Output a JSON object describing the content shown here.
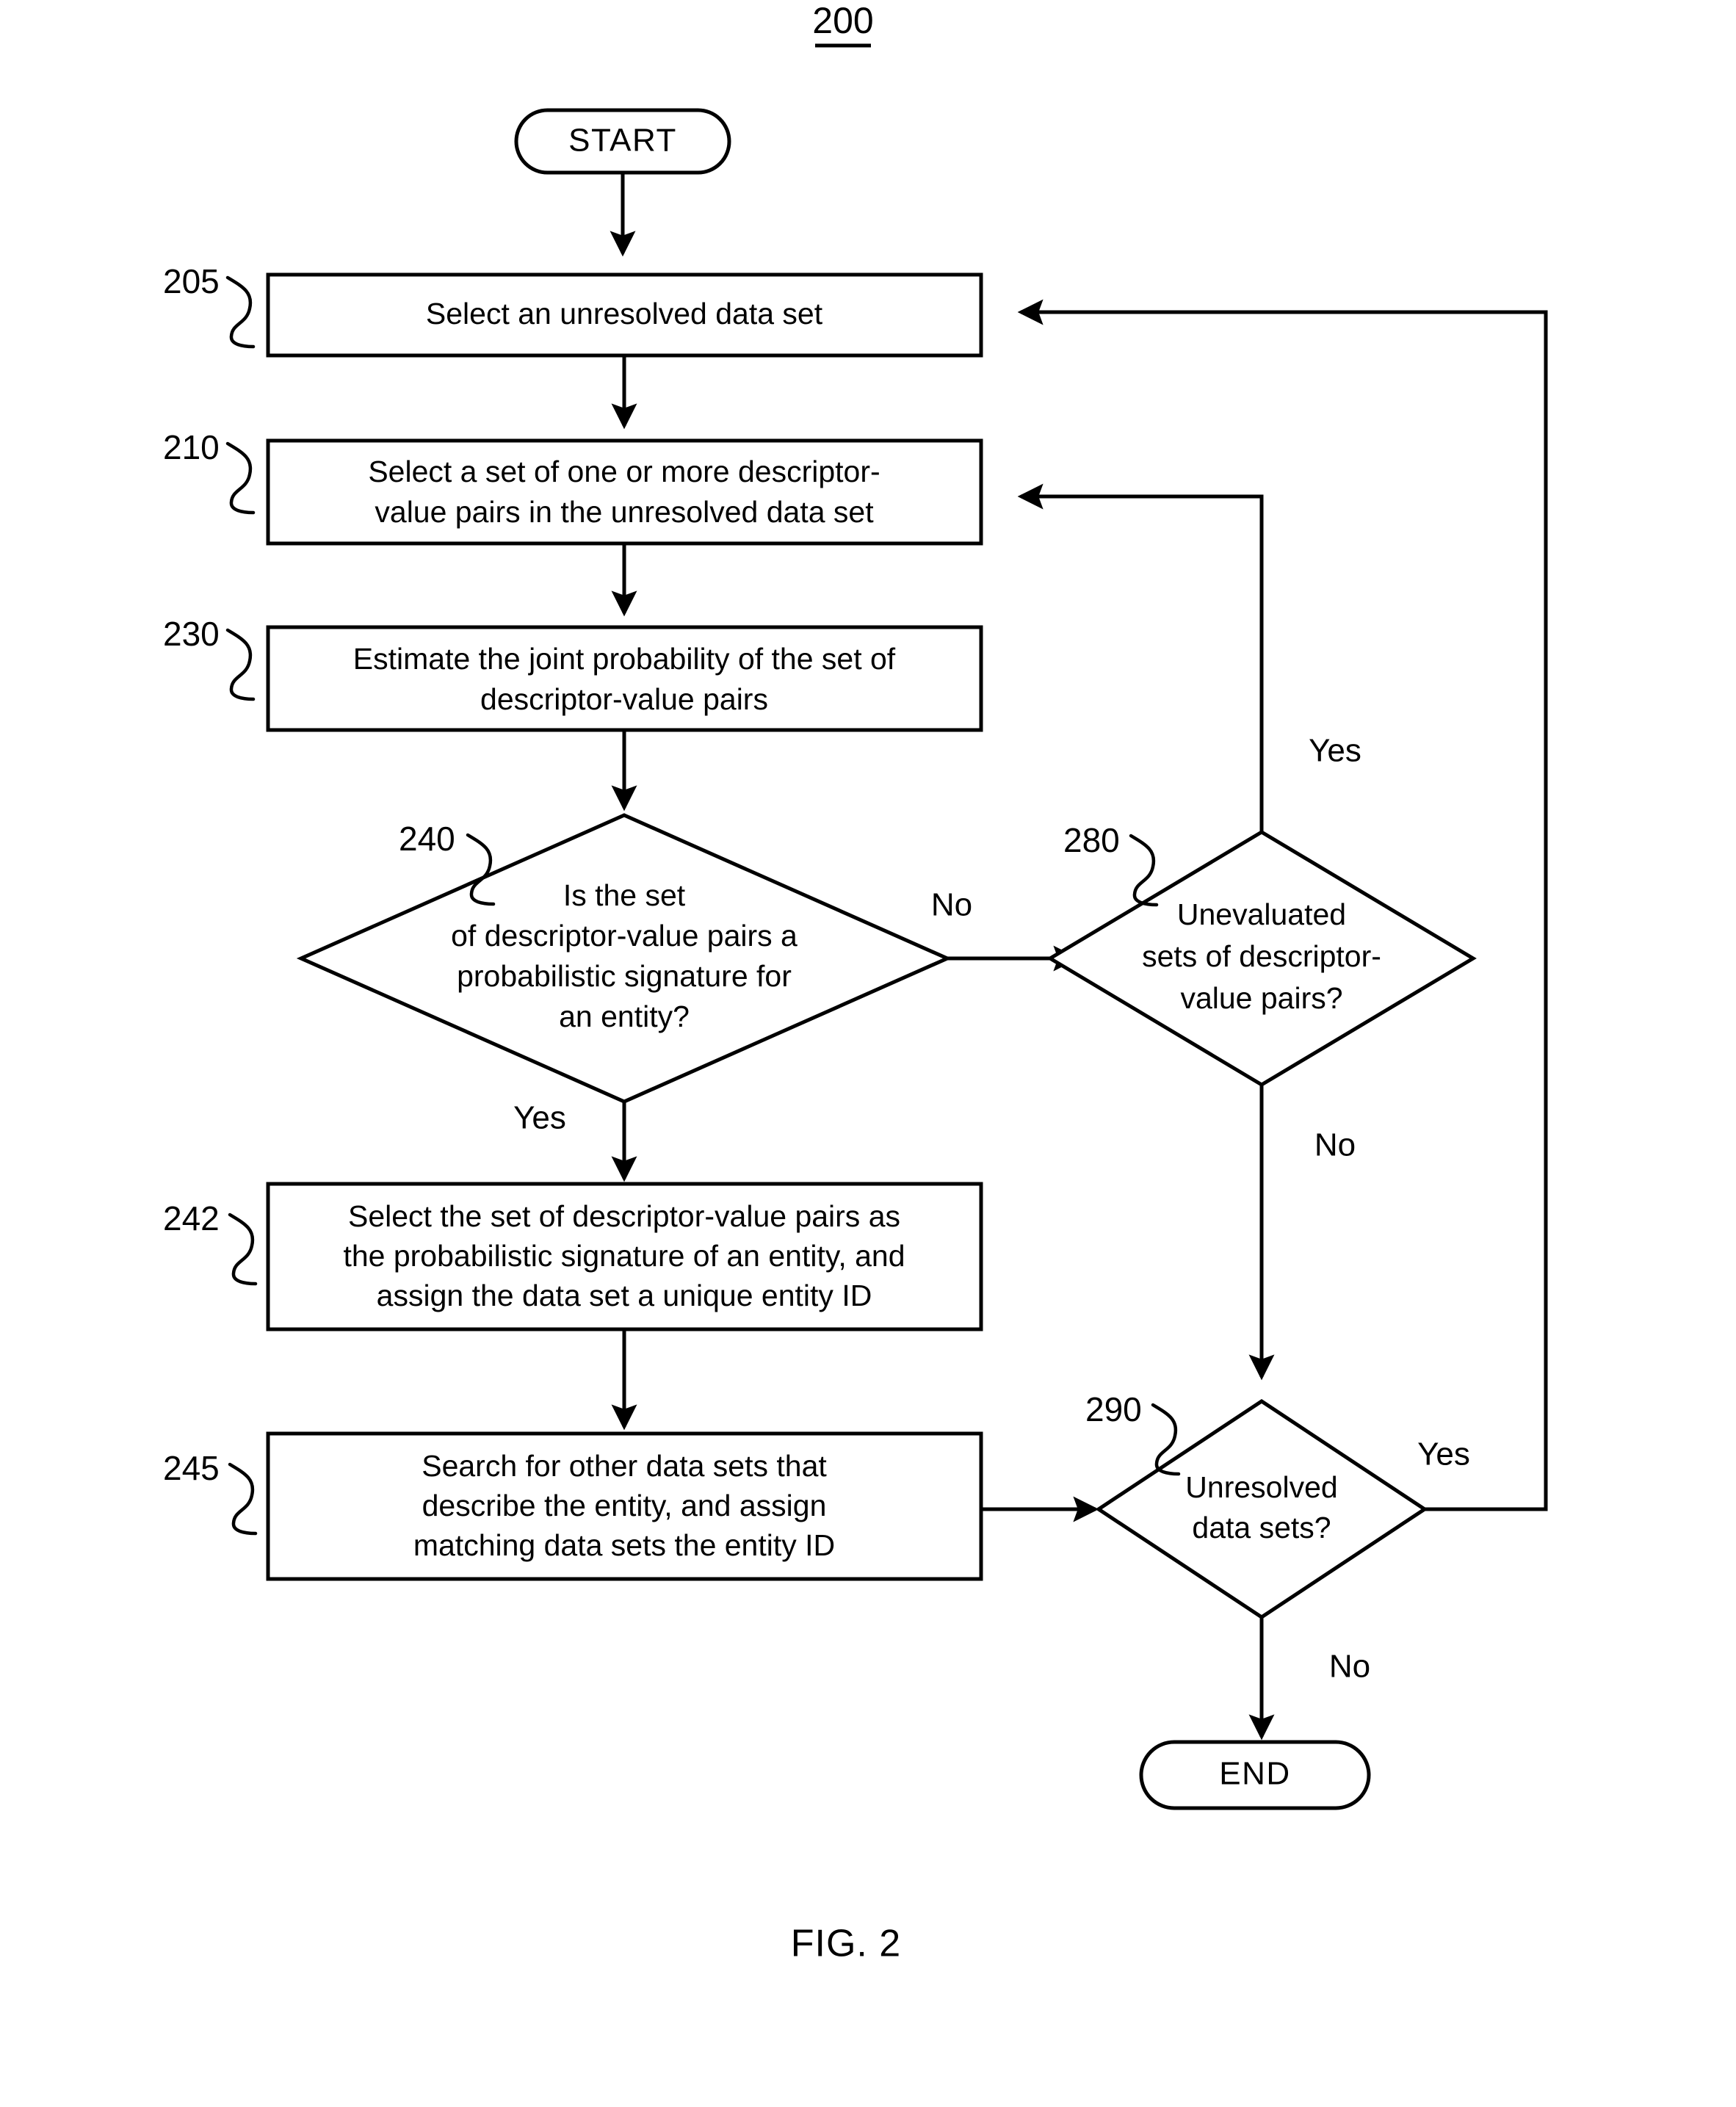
{
  "figure": {
    "number_label": "200",
    "caption": "FIG. 2"
  },
  "nodes": {
    "start": {
      "label": "START",
      "ref": ""
    },
    "end": {
      "label": "END",
      "ref": ""
    },
    "step205": {
      "ref": "205",
      "lines": [
        "Select an unresolved data set"
      ]
    },
    "step210": {
      "ref": "210",
      "lines": [
        "Select a set of one or more descriptor-",
        "value pairs in the unresolved data set"
      ]
    },
    "step230": {
      "ref": "230",
      "lines": [
        "Estimate the joint probability of the set of",
        "descriptor-value pairs"
      ]
    },
    "decision240": {
      "ref": "240",
      "lines": [
        "Is the set",
        "of descriptor-value pairs a",
        "probabilistic signature for",
        "an entity?"
      ]
    },
    "decision280": {
      "ref": "280",
      "lines": [
        "Unevaluated",
        "sets of descriptor-",
        "value pairs?"
      ]
    },
    "step242": {
      "ref": "242",
      "lines": [
        "Select the set of descriptor-value pairs as",
        "the probabilistic signature of an entity, and",
        "assign the data set a unique entity ID"
      ]
    },
    "step245": {
      "ref": "245",
      "lines": [
        "Search for other data sets that",
        "describe the entity, and assign",
        "matching data sets the entity ID"
      ]
    },
    "decision290": {
      "ref": "290",
      "lines": [
        "Unresolved",
        "data sets?"
      ]
    }
  },
  "branch_labels": {
    "d240_no": "No",
    "d240_yes": "Yes",
    "d280_yes": "Yes",
    "d280_no": "No",
    "d290_yes": "Yes",
    "d290_no": "No"
  },
  "colors": {
    "stroke": "#000000",
    "fill": "#ffffff",
    "text": "#000000"
  }
}
